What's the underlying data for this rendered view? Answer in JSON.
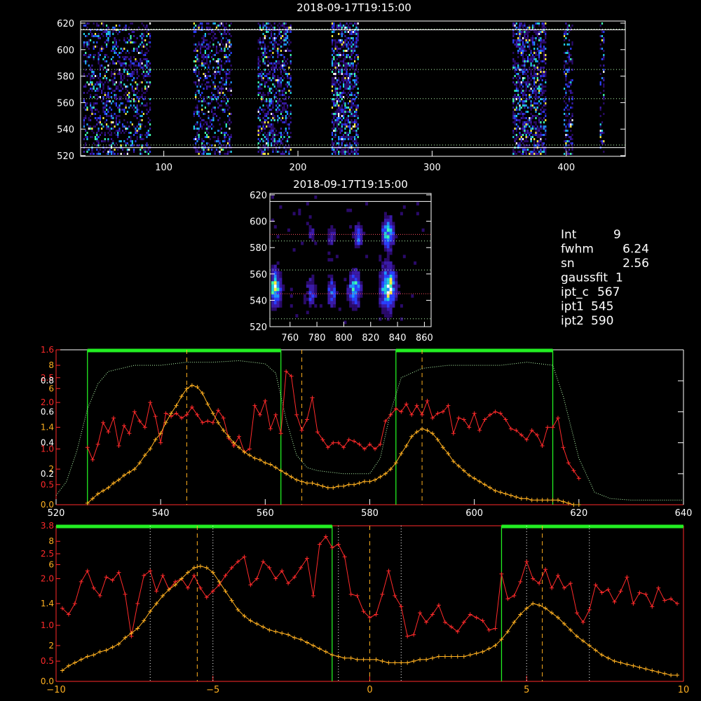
{
  "colors": {
    "fg": "#ffffff",
    "red": "#ff2a2a",
    "orange": "#ffb020",
    "green": "#22ee22",
    "lightgreen": "#b8ffb0",
    "dark_red_axis": "#ff2020"
  },
  "top_panel": {
    "title": "2018-09-17T19:15:00",
    "xticks": [
      "100",
      "200",
      "300",
      "400"
    ],
    "yticks": [
      "520",
      "540",
      "560",
      "580",
      "600",
      "620"
    ]
  },
  "mid_panel": {
    "title": "2018-09-17T19:15:00",
    "xticks": [
      "760",
      "780",
      "800",
      "820",
      "840",
      "860"
    ],
    "yticks": [
      "520",
      "540",
      "560",
      "580",
      "600",
      "620"
    ]
  },
  "info": [
    {
      "k": "Int",
      "v": "9"
    },
    {
      "k": "fwhm",
      "v": "6.24"
    },
    {
      "k": "sn",
      "v": "2.56"
    },
    {
      "k": "gaussfit",
      "v": "1"
    },
    {
      "k": "ipt_c",
      "v": "567"
    },
    {
      "k": "ipt1",
      "v": "545"
    },
    {
      "k": "ipt2",
      "v": "590"
    }
  ],
  "chart_data": [
    {
      "type": "line",
      "id": "profile",
      "xlim": [
        520,
        640
      ],
      "xticks": [
        "520",
        "540",
        "560",
        "580",
        "600",
        "620",
        "640"
      ],
      "yticks_white": [
        "0.2",
        "0.4",
        "0.6",
        "0.8"
      ],
      "yticks_red": [
        "0.0",
        "0.5",
        "2",
        "1.0",
        "1.4",
        "2.0",
        "6",
        "2.5",
        "8",
        "1.6"
      ],
      "vlines_dashed": [
        545,
        567,
        590
      ],
      "green_boxes": [
        [
          526,
          563
        ],
        [
          585,
          615
        ]
      ],
      "dotted_profile": {
        "x": [
          520,
          522,
          524,
          526,
          528,
          530,
          535,
          540,
          545,
          550,
          555,
          560,
          562,
          564,
          566,
          568,
          570,
          575,
          580,
          582,
          584,
          586,
          590,
          595,
          600,
          605,
          610,
          615,
          617,
          620,
          623,
          626,
          630,
          635,
          640
        ],
        "y": [
          0.06,
          0.15,
          0.35,
          0.62,
          0.78,
          0.86,
          0.9,
          0.9,
          0.92,
          0.92,
          0.93,
          0.91,
          0.85,
          0.55,
          0.32,
          0.24,
          0.22,
          0.2,
          0.2,
          0.3,
          0.6,
          0.82,
          0.88,
          0.9,
          0.9,
          0.9,
          0.92,
          0.9,
          0.7,
          0.3,
          0.08,
          0.04,
          0.03,
          0.03,
          0.03
        ]
      },
      "series": [
        {
          "name": "",
          "color": "red",
          "x": [
            526,
            527,
            528,
            529,
            530,
            531,
            532,
            533,
            534,
            535,
            536,
            537,
            538,
            539,
            540,
            541,
            542,
            543,
            544,
            545,
            546,
            547,
            548,
            549,
            550,
            551,
            552,
            553,
            554,
            555,
            556,
            557,
            558,
            559,
            560,
            561,
            562,
            563,
            564,
            565,
            566,
            567,
            568,
            569,
            570,
            571,
            572,
            573,
            574,
            575,
            576,
            577,
            578,
            579,
            580,
            581,
            582,
            583,
            584,
            585,
            586,
            587,
            588,
            589,
            590,
            591,
            592,
            593,
            594,
            595,
            596,
            597,
            598,
            599,
            600,
            601,
            602,
            603,
            604,
            605,
            606,
            607,
            608,
            609,
            610,
            611,
            612,
            613,
            614,
            615,
            616,
            617,
            618,
            619,
            620
          ],
          "y": [
            0.37,
            0.29,
            0.39,
            0.53,
            0.47,
            0.56,
            0.38,
            0.51,
            0.46,
            0.6,
            0.54,
            0.5,
            0.66,
            0.57,
            0.4,
            0.59,
            0.57,
            0.59,
            0.56,
            0.58,
            0.63,
            0.58,
            0.53,
            0.54,
            0.53,
            0.61,
            0.56,
            0.43,
            0.38,
            0.44,
            0.34,
            0.36,
            0.64,
            0.58,
            0.67,
            0.49,
            0.58,
            0.46,
            0.86,
            0.83,
            0.58,
            0.48,
            0.55,
            0.69,
            0.47,
            0.42,
            0.37,
            0.4,
            0.4,
            0.37,
            0.42,
            0.41,
            0.39,
            0.36,
            0.39,
            0.36,
            0.39,
            0.54,
            0.58,
            0.62,
            0.6,
            0.65,
            0.58,
            0.64,
            0.58,
            0.67,
            0.56,
            0.59,
            0.6,
            0.64,
            0.46,
            0.56,
            0.55,
            0.5,
            0.59,
            0.48,
            0.55,
            0.58,
            0.6,
            0.59,
            0.55,
            0.49,
            0.48,
            0.45,
            0.42,
            0.48,
            0.45,
            0.38,
            0.5,
            0.5,
            0.56,
            0.37,
            0.27,
            0.22,
            0.17
          ]
        },
        {
          "name": "",
          "color": "orange",
          "x": [
            526,
            527,
            528,
            529,
            530,
            531,
            532,
            533,
            534,
            535,
            536,
            537,
            538,
            539,
            540,
            541,
            542,
            543,
            544,
            545,
            546,
            547,
            548,
            549,
            550,
            551,
            552,
            553,
            554,
            555,
            556,
            557,
            558,
            559,
            560,
            561,
            562,
            563,
            564,
            565,
            566,
            567,
            568,
            569,
            570,
            571,
            572,
            573,
            574,
            575,
            576,
            577,
            578,
            579,
            580,
            581,
            582,
            583,
            584,
            585,
            586,
            587,
            588,
            589,
            590,
            591,
            592,
            593,
            594,
            595,
            596,
            597,
            598,
            599,
            600,
            601,
            602,
            603,
            604,
            605,
            606,
            607,
            608,
            609,
            610,
            611,
            612,
            613,
            614,
            615,
            616,
            617,
            618,
            619,
            620
          ],
          "y": [
            0.01,
            0.04,
            0.07,
            0.09,
            0.11,
            0.14,
            0.16,
            0.19,
            0.21,
            0.23,
            0.27,
            0.32,
            0.36,
            0.42,
            0.46,
            0.53,
            0.59,
            0.64,
            0.7,
            0.75,
            0.77,
            0.76,
            0.72,
            0.65,
            0.59,
            0.53,
            0.48,
            0.44,
            0.4,
            0.37,
            0.34,
            0.32,
            0.3,
            0.29,
            0.27,
            0.26,
            0.24,
            0.22,
            0.2,
            0.18,
            0.16,
            0.15,
            0.14,
            0.14,
            0.13,
            0.12,
            0.11,
            0.11,
            0.12,
            0.12,
            0.13,
            0.13,
            0.14,
            0.15,
            0.15,
            0.16,
            0.18,
            0.2,
            0.23,
            0.27,
            0.33,
            0.38,
            0.44,
            0.47,
            0.49,
            0.48,
            0.46,
            0.42,
            0.37,
            0.33,
            0.28,
            0.25,
            0.22,
            0.19,
            0.17,
            0.15,
            0.13,
            0.11,
            0.09,
            0.08,
            0.07,
            0.06,
            0.05,
            0.04,
            0.04,
            0.03,
            0.03,
            0.03,
            0.03,
            0.03,
            0.03,
            0.02,
            0.01,
            0.0,
            0.0
          ]
        }
      ]
    },
    {
      "type": "line",
      "id": "profile_centered",
      "xlim": [
        -10,
        10
      ],
      "xticks": [
        "−10",
        "−5",
        "0",
        "5",
        "10"
      ],
      "yticks_red": [
        "0.0",
        "0.5",
        "2",
        "1.0",
        "1.4",
        "2.0",
        "6",
        "2.5",
        "8",
        "3.8"
      ],
      "vlines_dashed": [
        -5.5,
        0,
        5.5
      ],
      "vlines_dotted": [
        -7,
        -5,
        -1,
        1,
        5,
        7
      ],
      "green_boxes": [
        [
          -10.5,
          -1.2
        ],
        [
          4.2,
          10
        ]
      ],
      "series": [
        {
          "name": "",
          "color": "red",
          "x": [
            -9.8,
            -9.6,
            -9.4,
            -9.2,
            -9.0,
            -8.8,
            -8.6,
            -8.4,
            -8.2,
            -8.0,
            -7.8,
            -7.6,
            -7.4,
            -7.2,
            -7.0,
            -6.8,
            -6.6,
            -6.4,
            -6.2,
            -6.0,
            -5.8,
            -5.6,
            -5.4,
            -5.2,
            -5.0,
            -4.8,
            -4.6,
            -4.4,
            -4.2,
            -4.0,
            -3.8,
            -3.6,
            -3.4,
            -3.2,
            -3.0,
            -2.8,
            -2.6,
            -2.4,
            -2.2,
            -2.0,
            -1.8,
            -1.6,
            -1.4,
            -1.2,
            -1.0,
            -0.8,
            -0.6,
            -0.4,
            -0.2,
            0.0,
            0.2,
            0.4,
            0.6,
            0.8,
            1.0,
            1.2,
            1.4,
            1.6,
            1.8,
            2.0,
            2.2,
            2.4,
            2.6,
            2.8,
            3.0,
            3.2,
            3.4,
            3.6,
            3.8,
            4.0,
            4.2,
            4.4,
            4.6,
            4.8,
            5.0,
            5.2,
            5.4,
            5.6,
            5.8,
            6.0,
            6.2,
            6.4,
            6.6,
            6.8,
            7.0,
            7.2,
            7.4,
            7.6,
            7.8,
            8.0,
            8.2,
            8.4,
            8.6,
            8.8,
            9.0,
            9.2,
            9.4,
            9.6,
            9.8
          ],
          "y": [
            0.47,
            0.43,
            0.5,
            0.64,
            0.71,
            0.6,
            0.55,
            0.67,
            0.65,
            0.7,
            0.56,
            0.29,
            0.5,
            0.68,
            0.71,
            0.58,
            0.68,
            0.59,
            0.64,
            0.66,
            0.6,
            0.68,
            0.6,
            0.54,
            0.58,
            0.62,
            0.68,
            0.73,
            0.77,
            0.8,
            0.62,
            0.66,
            0.77,
            0.73,
            0.66,
            0.71,
            0.63,
            0.67,
            0.73,
            0.79,
            0.55,
            0.88,
            0.93,
            0.86,
            0.88,
            0.8,
            0.56,
            0.55,
            0.45,
            0.41,
            0.43,
            0.56,
            0.71,
            0.55,
            0.48,
            0.29,
            0.3,
            0.44,
            0.38,
            0.43,
            0.49,
            0.38,
            0.35,
            0.32,
            0.38,
            0.43,
            0.41,
            0.39,
            0.33,
            0.34,
            0.69,
            0.53,
            0.55,
            0.64,
            0.77,
            0.66,
            0.63,
            0.72,
            0.6,
            0.68,
            0.6,
            0.63,
            0.44,
            0.38,
            0.46,
            0.62,
            0.57,
            0.59,
            0.51,
            0.58,
            0.67,
            0.5,
            0.57,
            0.56,
            0.48,
            0.6,
            0.52,
            0.53,
            0.5
          ]
        },
        {
          "name": "",
          "color": "orange",
          "x": [
            -9.8,
            -9.6,
            -9.4,
            -9.2,
            -9.0,
            -8.8,
            -8.6,
            -8.4,
            -8.2,
            -8.0,
            -7.8,
            -7.6,
            -7.4,
            -7.2,
            -7.0,
            -6.8,
            -6.6,
            -6.4,
            -6.2,
            -6.0,
            -5.8,
            -5.6,
            -5.4,
            -5.2,
            -5.0,
            -4.8,
            -4.6,
            -4.4,
            -4.2,
            -4.0,
            -3.8,
            -3.6,
            -3.4,
            -3.2,
            -3.0,
            -2.8,
            -2.6,
            -2.4,
            -2.2,
            -2.0,
            -1.8,
            -1.6,
            -1.4,
            -1.2,
            -1.0,
            -0.8,
            -0.6,
            -0.4,
            -0.2,
            0.0,
            0.2,
            0.4,
            0.6,
            0.8,
            1.0,
            1.2,
            1.4,
            1.6,
            1.8,
            2.0,
            2.2,
            2.4,
            2.6,
            2.8,
            3.0,
            3.2,
            3.4,
            3.6,
            3.8,
            4.0,
            4.2,
            4.4,
            4.6,
            4.8,
            5.0,
            5.2,
            5.4,
            5.6,
            5.8,
            6.0,
            6.2,
            6.4,
            6.6,
            6.8,
            7.0,
            7.2,
            7.4,
            7.6,
            7.8,
            8.0,
            8.2,
            8.4,
            8.6,
            8.8,
            9.0,
            9.2,
            9.4,
            9.6,
            9.8
          ],
          "y": [
            0.07,
            0.1,
            0.12,
            0.14,
            0.16,
            0.17,
            0.19,
            0.2,
            0.22,
            0.24,
            0.28,
            0.31,
            0.34,
            0.39,
            0.45,
            0.5,
            0.55,
            0.59,
            0.62,
            0.66,
            0.7,
            0.73,
            0.74,
            0.73,
            0.7,
            0.64,
            0.58,
            0.52,
            0.46,
            0.42,
            0.39,
            0.37,
            0.35,
            0.33,
            0.32,
            0.31,
            0.3,
            0.28,
            0.27,
            0.25,
            0.23,
            0.21,
            0.19,
            0.17,
            0.16,
            0.15,
            0.15,
            0.14,
            0.14,
            0.14,
            0.14,
            0.13,
            0.12,
            0.12,
            0.12,
            0.12,
            0.13,
            0.14,
            0.14,
            0.15,
            0.16,
            0.16,
            0.16,
            0.16,
            0.16,
            0.17,
            0.18,
            0.19,
            0.21,
            0.23,
            0.27,
            0.32,
            0.38,
            0.43,
            0.47,
            0.5,
            0.49,
            0.47,
            0.44,
            0.41,
            0.37,
            0.33,
            0.29,
            0.26,
            0.23,
            0.2,
            0.17,
            0.15,
            0.13,
            0.12,
            0.11,
            0.1,
            0.09,
            0.08,
            0.07,
            0.06,
            0.05,
            0.04,
            0.04
          ]
        }
      ]
    }
  ]
}
